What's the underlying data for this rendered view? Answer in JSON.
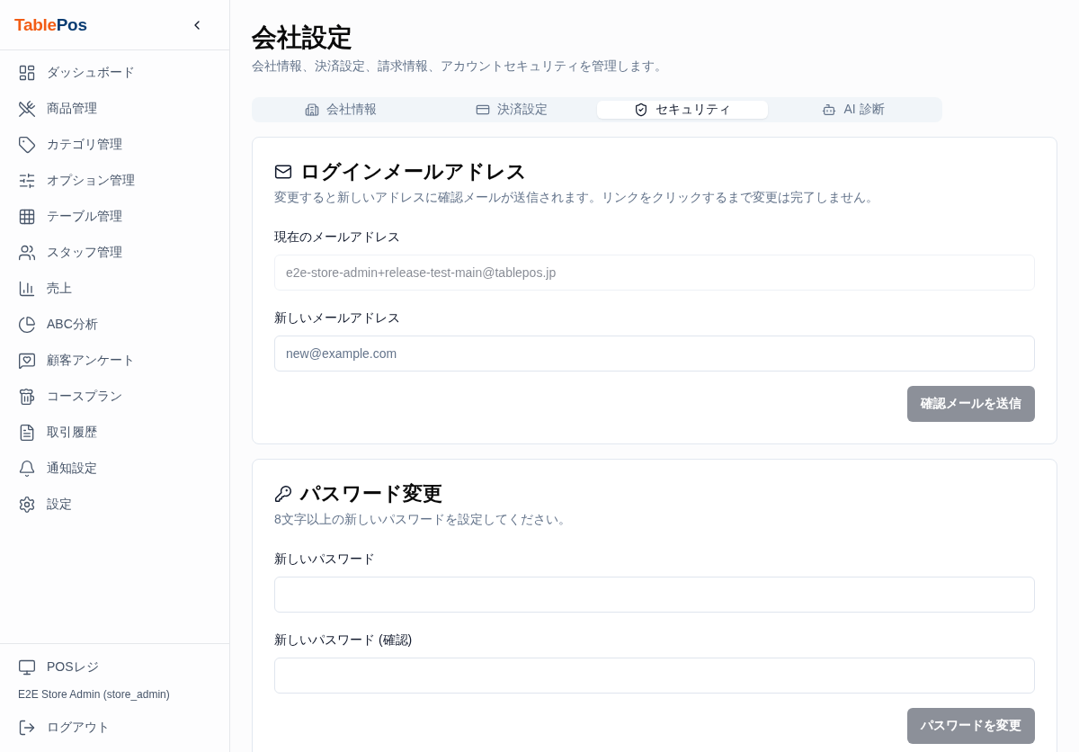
{
  "sidebar": {
    "logo": {
      "part_1": "Table",
      "part_2": "Pos"
    },
    "nav": [
      {
        "label": "ダッシュボード",
        "selected": false
      },
      {
        "label": "商品管理",
        "selected": false
      },
      {
        "label": "カテゴリ管理",
        "selected": false
      },
      {
        "label": "オプション管理",
        "selected": false
      },
      {
        "label": "テーブル管理",
        "selected": false
      },
      {
        "label": "スタッフ管理",
        "selected": false
      },
      {
        "label": "売上",
        "selected": false
      },
      {
        "label": "ABC分析",
        "selected": false
      },
      {
        "label": "顧客アンケート",
        "selected": false
      },
      {
        "label": "コースプラン",
        "selected": false
      },
      {
        "label": "取引履歴",
        "selected": false
      },
      {
        "label": "通知設定",
        "selected": false
      },
      {
        "label": "設定",
        "selected": false
      }
    ],
    "footer": {
      "pos_link": "POSレジ",
      "user": "E2E Store Admin (store_admin)",
      "logout": "ログアウト"
    }
  },
  "page": {
    "title": "会社設定",
    "subtitle": "会社情報、決済設定、請求情報、アカウントセキュリティを管理します。"
  },
  "tabs": [
    {
      "label": "会社情報",
      "selected": false
    },
    {
      "label": "決済設定",
      "selected": false
    },
    {
      "label": "セキュリティ",
      "selected": true
    },
    {
      "label": "AI 診断",
      "selected": false
    }
  ],
  "sections": [
    {
      "title": "ログインメールアドレス",
      "description": "変更すると新しいアドレスに確認メールが送信されます。リンクをクリックするまで変更は完了しません。",
      "fields": [
        {
          "label": "現在のメールアドレス",
          "kind": "email",
          "value": "e2e-store-admin+release-test-main@tablepos.jp",
          "disabled": true
        },
        {
          "label": "新しいメールアドレス",
          "kind": "email",
          "placeholder": "new@example.com",
          "disabled": false
        }
      ],
      "button": {
        "label": "確認メールを送信",
        "disabled": true
      }
    },
    {
      "title": "パスワード変更",
      "description": "8文字以上の新しいパスワードを設定してください。",
      "fields": [
        {
          "label": "新しいパスワード",
          "kind": "password"
        },
        {
          "label": "新しいパスワード (確認)",
          "kind": "password"
        }
      ],
      "button": {
        "label": "パスワードを変更",
        "disabled": true
      }
    }
  ]
}
